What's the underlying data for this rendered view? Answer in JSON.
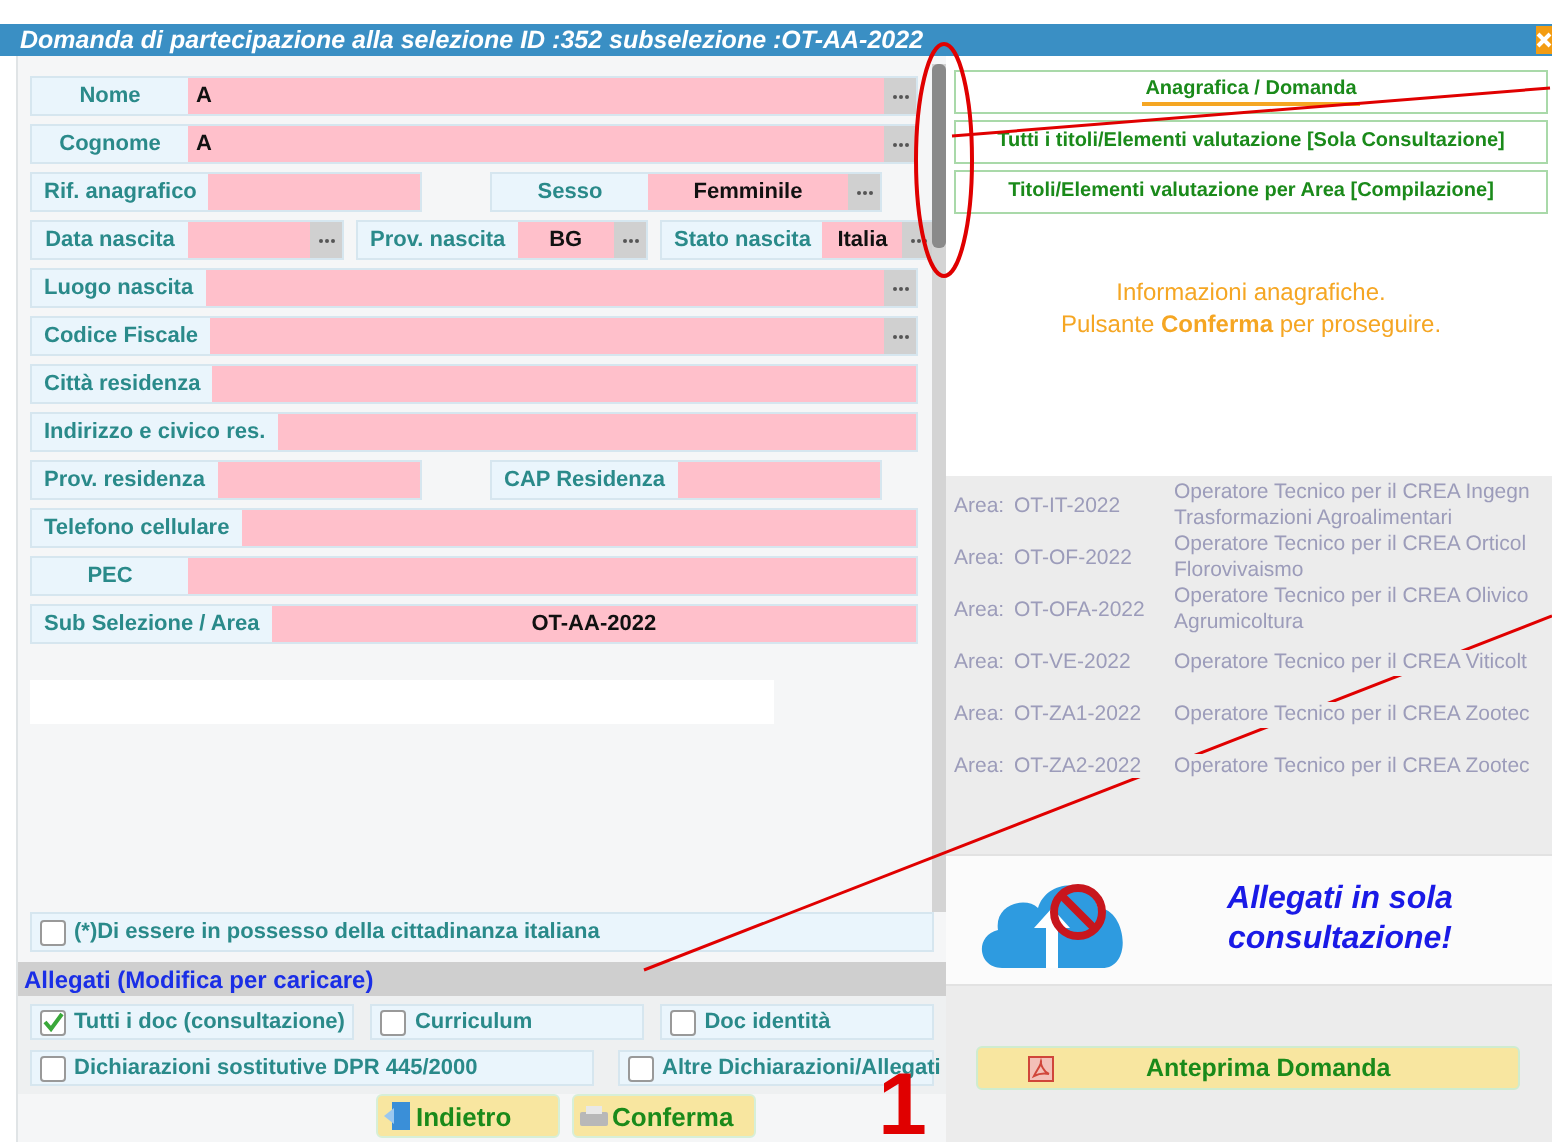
{
  "window": {
    "title": "Domanda di partecipazione alla selezione ID :352  subselezione :OT-AA-2022"
  },
  "form_rows": [
    {
      "kind": "full",
      "fields": [
        {
          "label": "Nome",
          "value": "A",
          "picker": true
        }
      ]
    },
    {
      "kind": "full",
      "fields": [
        {
          "label": "Cognome",
          "value": "A",
          "picker": true
        }
      ]
    },
    {
      "kind": "pair",
      "fields": [
        {
          "label": "Rif. anagrafico",
          "picker": false
        },
        {
          "label": "Sesso",
          "value": "Femminile",
          "picker": true
        }
      ]
    },
    {
      "kind": "triple",
      "fields": [
        {
          "label": "Data nascita",
          "picker": true
        },
        {
          "label": "Prov. nascita",
          "value": "BG",
          "picker": true
        },
        {
          "label": "Stato nascita",
          "value": "Italia",
          "picker": true
        }
      ]
    },
    {
      "kind": "full",
      "fields": [
        {
          "label": "Luogo nascita",
          "picker": true
        }
      ]
    },
    {
      "kind": "full",
      "fields": [
        {
          "label": "Codice Fiscale",
          "picker": true
        }
      ]
    },
    {
      "kind": "full",
      "fields": [
        {
          "label": "Città  residenza",
          "picker": false
        }
      ]
    },
    {
      "kind": "full",
      "fields": [
        {
          "label": "Indirizzo e civico res.",
          "picker": false
        }
      ]
    },
    {
      "kind": "pair",
      "fields": [
        {
          "label": "Prov. residenza",
          "picker": false
        },
        {
          "label": "CAP Residenza",
          "picker": false
        }
      ]
    },
    {
      "kind": "full",
      "fields": [
        {
          "label": "Telefono cellulare",
          "picker": false
        }
      ]
    },
    {
      "kind": "full",
      "fields": [
        {
          "label": "PEC",
          "picker": false
        }
      ]
    },
    {
      "kind": "full",
      "fields": [
        {
          "label": "Sub Selezione / Area",
          "value": "OT-AA-2022",
          "picker": false
        }
      ]
    }
  ],
  "citizenship": {
    "label": "(*)Di essere in possesso della cittadinanza italiana",
    "checked": false
  },
  "attachments": {
    "title": "Allegati (Modifica per caricare)",
    "items": [
      {
        "label": "Tutti i doc (consultazione)",
        "checked": true
      },
      {
        "label": "Curriculum",
        "checked": false
      },
      {
        "label": "Doc identità",
        "checked": false
      },
      {
        "label": "Dichiarazioni sostitutive DPR 445/2000",
        "checked": false
      },
      {
        "label": "Altre Dichiarazioni/Allegati",
        "checked": false
      }
    ]
  },
  "buttons": [
    {
      "label": "Indietro",
      "kind": "back"
    },
    {
      "label": "Conferma",
      "kind": "confirm"
    }
  ],
  "tabs": [
    {
      "label": "Anagrafica / Domanda",
      "selected": true
    },
    {
      "label": "Tutti i titoli/Elementi valutazione [Sola Consultazione]",
      "selected": false
    },
    {
      "label": "Titoli/Elementi valutazione per Area [Compilazione]",
      "selected": false
    }
  ],
  "info": [
    "Informazioni anagrafiche.",
    "Pulsante **Conferma** per proseguire."
  ],
  "background_rows": [
    {
      "area_label": "Area:",
      "code": "OT-IT-2022",
      "description": [
        "Operatore Tecnico per il CREA Ingegn",
        "Trasformazioni Agroalimentari"
      ]
    },
    {
      "area_label": "Area:",
      "code": "OT-OF-2022",
      "description": [
        "Operatore Tecnico per il CREA Orticol",
        "Florovivaismo"
      ]
    },
    {
      "area_label": "Area:",
      "code": "OT-OFA-2022",
      "description": [
        "Operatore Tecnico per il CREA Olivico",
        "Agrumicoltura"
      ]
    },
    {
      "area_label": "Area:",
      "code": "OT-VE-2022",
      "description": [
        "Operatore Tecnico per il CREA Viticolt"
      ]
    },
    {
      "area_label": "Area:",
      "code": "OT-ZA1-2022",
      "description": [
        "Operatore Tecnico per il CREA Zootec"
      ]
    },
    {
      "area_label": "Area:",
      "code": "OT-ZA2-2022",
      "description": [
        "Operatore Tecnico per il CREA Zootec"
      ]
    }
  ],
  "notice": {
    "text": "Allegati in sola consultazione!"
  },
  "preview_button": {
    "label": "Anteprima Domanda"
  },
  "annotation": {
    "label": "1"
  }
}
